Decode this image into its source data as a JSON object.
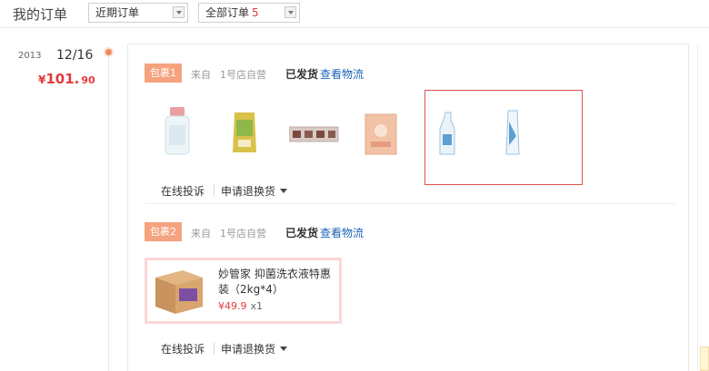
{
  "header": {
    "title": "我的订单",
    "period_select": "近期订单",
    "type_select": "全部订单",
    "type_count": "5"
  },
  "order": {
    "year": "2013",
    "date": "12/16",
    "price_symbol": "¥",
    "price_int": "101.",
    "price_dec": "90"
  },
  "packages": [
    {
      "badge": "包裹1",
      "from_label": "来自",
      "store": "1号店自营",
      "status": "已发货",
      "track_link": "查看物流",
      "complain": "在线投诉",
      "return": "申请退换货"
    },
    {
      "badge": "包裹2",
      "from_label": "来自",
      "store": "1号店自营",
      "status": "已发货",
      "track_link": "查看物流",
      "complain": "在线投诉",
      "return": "申请退换货",
      "item": {
        "name": "妙管家 抑菌洗衣液特惠装（2kg*4）",
        "price": "¥49.9",
        "qty": "x1"
      }
    }
  ],
  "product_images": [
    "baby-bottle",
    "formula-pouch",
    "pacifier-set",
    "wipes-box",
    "cleaner-bottle",
    "cleaner-refill"
  ],
  "colors": {
    "accent": "#e4393c",
    "badge": "#f5a27e",
    "link": "#1b62b6",
    "highlight_border": "#d9534f"
  }
}
